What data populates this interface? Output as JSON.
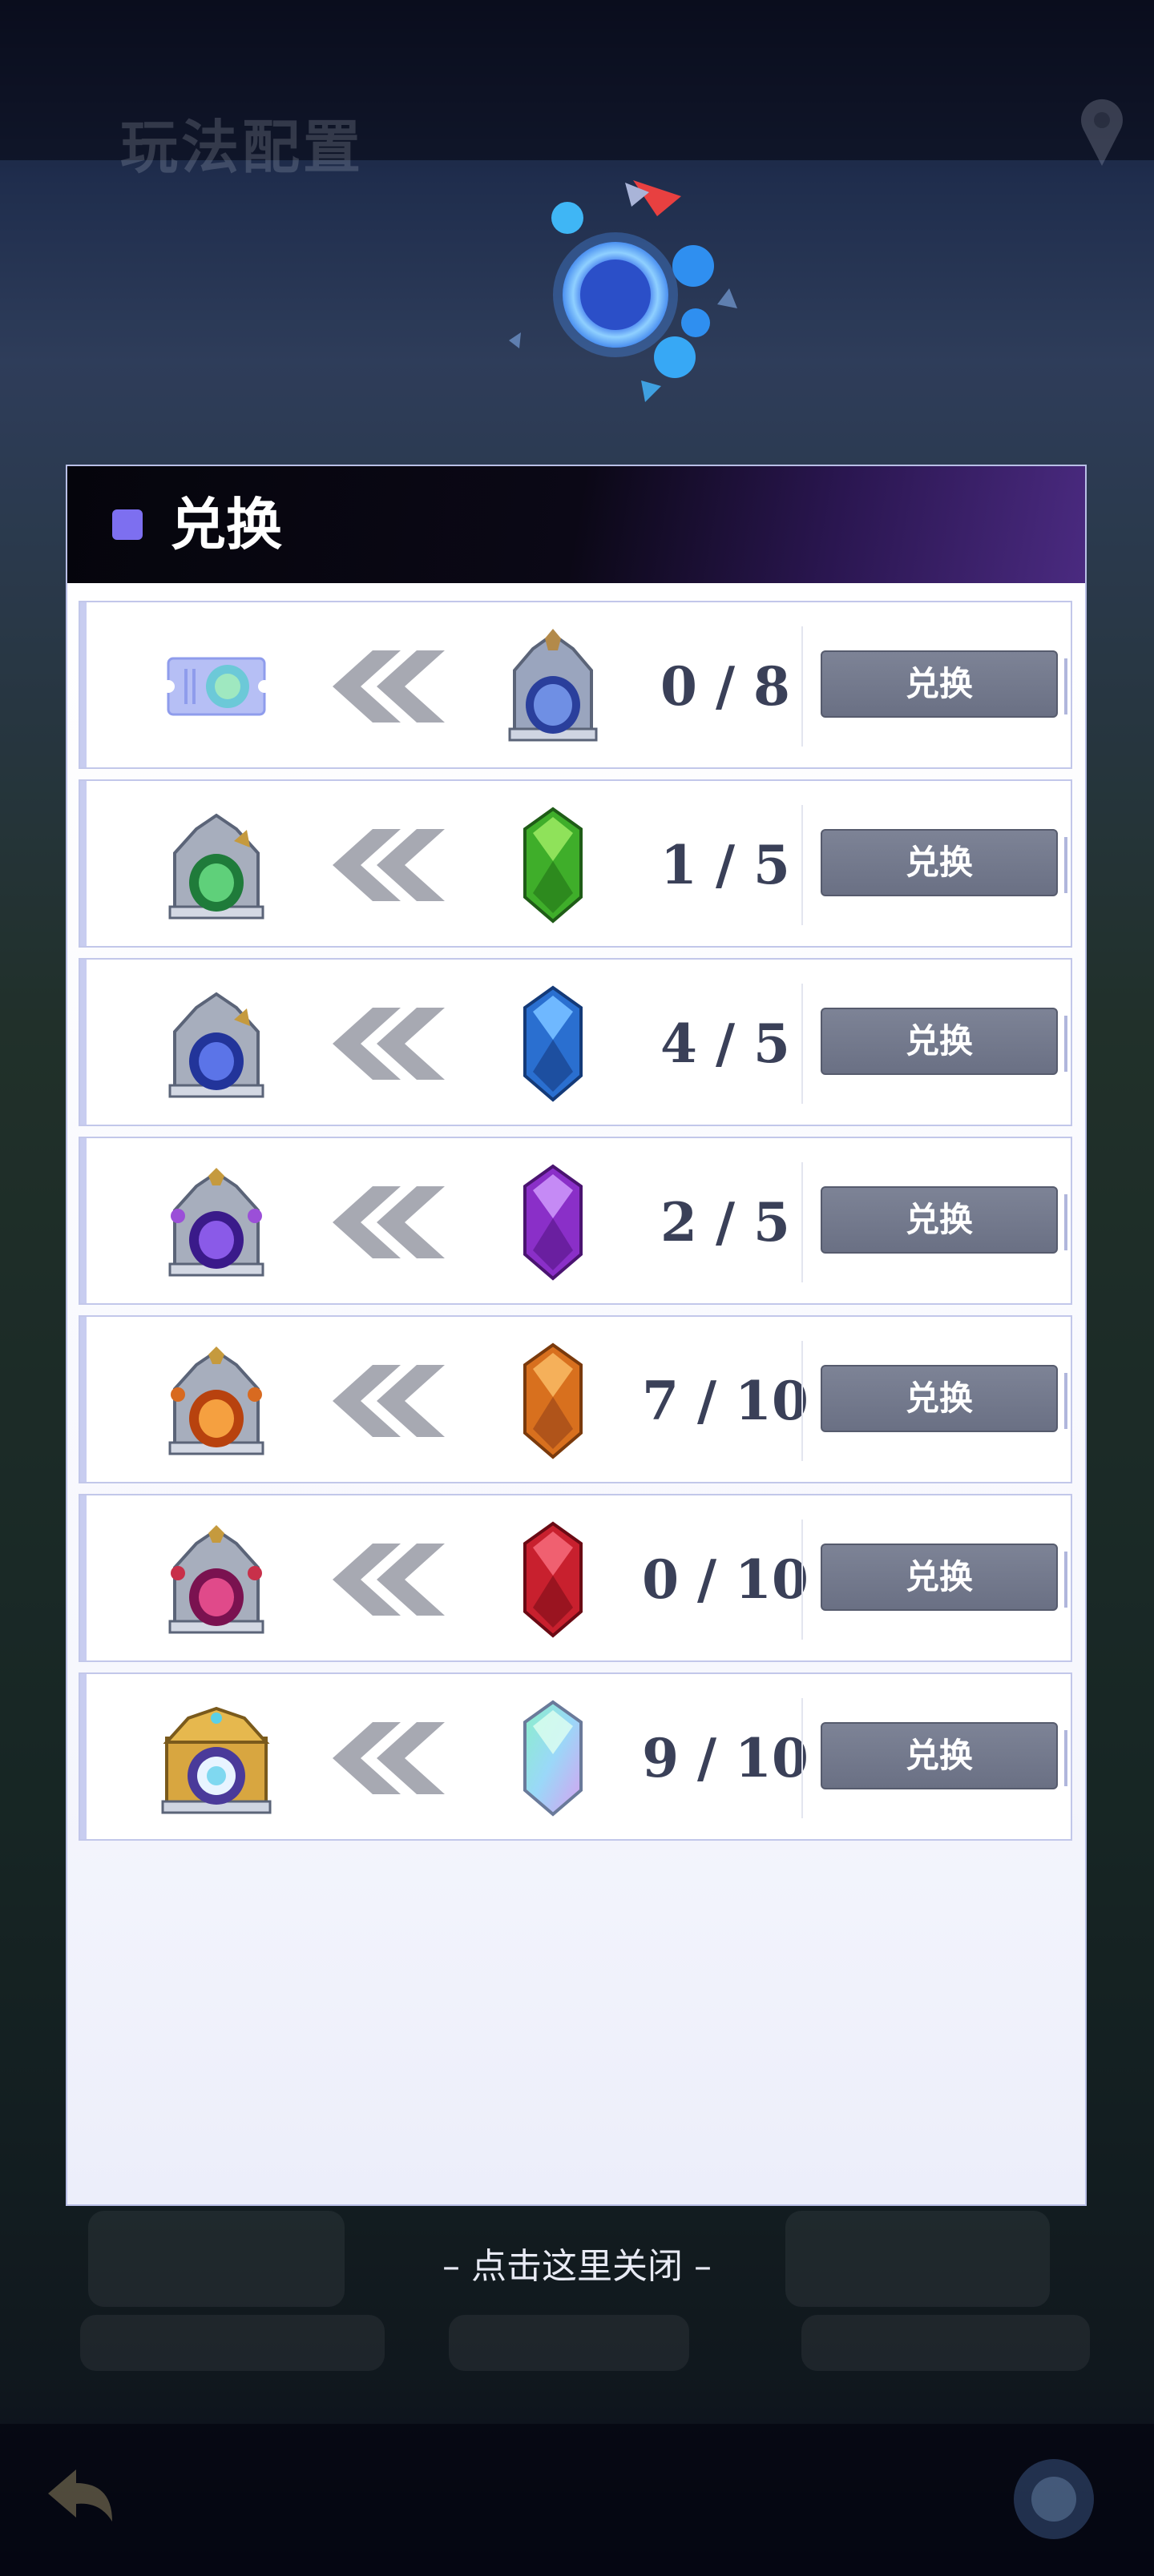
{
  "background": {
    "title": "玩法配置"
  },
  "panel": {
    "title": "兑换",
    "accent_color": "#7d6ff0"
  },
  "rows": [
    {
      "source_icon": "ticket-icon",
      "target_icon": "portal-gate-icon",
      "count": "0 / 8",
      "button_label": "兑换"
    },
    {
      "source_icon": "green-portal-icon",
      "target_icon": "green-crystal-icon",
      "count": "1 / 5",
      "button_label": "兑换"
    },
    {
      "source_icon": "blue-portal-icon",
      "target_icon": "blue-crystal-icon",
      "count": "4 / 5",
      "button_label": "兑换"
    },
    {
      "source_icon": "purple-portal-icon",
      "target_icon": "purple-crystal-icon",
      "count": "2 / 5",
      "button_label": "兑换"
    },
    {
      "source_icon": "orange-portal-icon",
      "target_icon": "orange-crystal-icon",
      "count": "7 / 10",
      "button_label": "兑换"
    },
    {
      "source_icon": "red-portal-icon",
      "target_icon": "red-crystal-icon",
      "count": "0 / 10",
      "button_label": "兑换"
    },
    {
      "source_icon": "golden-portal-icon",
      "target_icon": "rainbow-crystal-icon",
      "count": "9 / 10",
      "button_label": "兑换"
    }
  ],
  "close_hint": "– 点击这里关闭 –",
  "colors": {
    "button": "#737a8e",
    "count_text": "#3a4058",
    "row_border": "#c2c7ea"
  }
}
